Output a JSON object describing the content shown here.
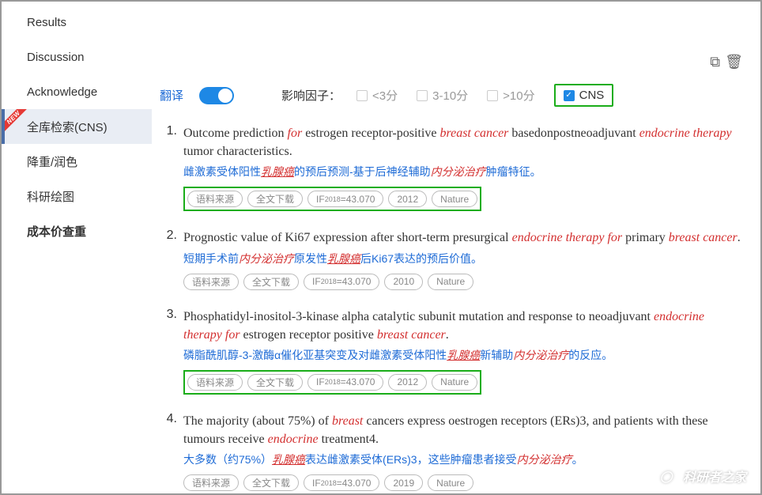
{
  "sidebar": {
    "items": [
      {
        "label": "Results"
      },
      {
        "label": "Discussion"
      },
      {
        "label": "Acknowledge"
      },
      {
        "label": "全库检索(CNS)",
        "active": true,
        "new_badge": "NEW"
      },
      {
        "label": "降重/润色"
      },
      {
        "label": "科研绘图"
      },
      {
        "label": "成本价查重",
        "bold": true
      }
    ]
  },
  "filters": {
    "translate_label": "翻译",
    "impact_label": "影响因子：",
    "options": [
      {
        "label": "<3分",
        "checked": false
      },
      {
        "label": "3-10分",
        "checked": false
      },
      {
        "label": ">10分",
        "checked": false
      },
      {
        "label": "CNS",
        "checked": true
      }
    ]
  },
  "tags_common": {
    "source": "语料来源",
    "download": "全文下载",
    "if_prefix": "IF",
    "if_year": "2018",
    "if_value": "=43.070",
    "journal": "Nature"
  },
  "results": [
    {
      "num": "1.",
      "title_parts": [
        {
          "t": "Outcome prediction "
        },
        {
          "t": "for",
          "ital": true
        },
        {
          "t": " estrogen receptor-positive "
        },
        {
          "t": "breast cancer",
          "ital": true
        },
        {
          "t": " basedonpostneoadjuvant "
        },
        {
          "t": "endocrine therapy",
          "ital": true
        },
        {
          "t": " tumor characteristics."
        }
      ],
      "zh_parts": [
        {
          "t": "雌激素受体阳性"
        },
        {
          "t": "乳腺癌",
          "italu": true
        },
        {
          "t": "的预后预测-基于后神经辅助"
        },
        {
          "t": "内分泌治疗",
          "ital": true
        },
        {
          "t": "肿瘤特征。"
        }
      ],
      "year": "2012",
      "highlight_tags": true
    },
    {
      "num": "2.",
      "title_parts": [
        {
          "t": "Prognostic value of Ki67 expression after short-term presurgical "
        },
        {
          "t": "endocrine therapy for",
          "ital": true
        },
        {
          "t": " primary "
        },
        {
          "t": "breast cancer",
          "ital": true
        },
        {
          "t": "."
        }
      ],
      "zh_parts": [
        {
          "t": "短期手术前"
        },
        {
          "t": "内分泌治疗",
          "ital": true
        },
        {
          "t": "原发性"
        },
        {
          "t": "乳腺癌",
          "italu": true
        },
        {
          "t": "后Ki67表达的预后价值。"
        }
      ],
      "year": "2010",
      "highlight_tags": false
    },
    {
      "num": "3.",
      "title_parts": [
        {
          "t": "Phosphatidyl-inositol-3-kinase alpha catalytic subunit mutation and response to neoadjuvant "
        },
        {
          "t": "endocrine therapy for",
          "ital": true
        },
        {
          "t": " estrogen receptor positive "
        },
        {
          "t": "breast cancer",
          "ital": true
        },
        {
          "t": "."
        }
      ],
      "zh_parts": [
        {
          "t": "磷脂酰肌醇-3-激酶α催化亚基突变及对雌激素受体阳性"
        },
        {
          "t": "乳腺癌",
          "italu": true
        },
        {
          "t": "新辅助"
        },
        {
          "t": "内分泌治疗",
          "ital": true
        },
        {
          "t": "的反应。"
        }
      ],
      "year": "2012",
      "highlight_tags": true
    },
    {
      "num": "4.",
      "title_parts": [
        {
          "t": "The majority (about 75%) of "
        },
        {
          "t": "breast",
          "ital": true
        },
        {
          "t": " cancers express oestrogen receptors (ERs)3, and patients with these tumours receive "
        },
        {
          "t": "endocrine",
          "ital": true
        },
        {
          "t": " treatment4."
        }
      ],
      "zh_parts": [
        {
          "t": "大多数（约75%）"
        },
        {
          "t": "乳腺癌",
          "italu": true
        },
        {
          "t": "表达雌激素受体(ERs)3，这些肿瘤患者接受"
        },
        {
          "t": "内分泌治疗",
          "ital": true
        },
        {
          "t": "。"
        }
      ],
      "year": "2019",
      "highlight_tags": false
    }
  ],
  "watermark": "科研者之家"
}
